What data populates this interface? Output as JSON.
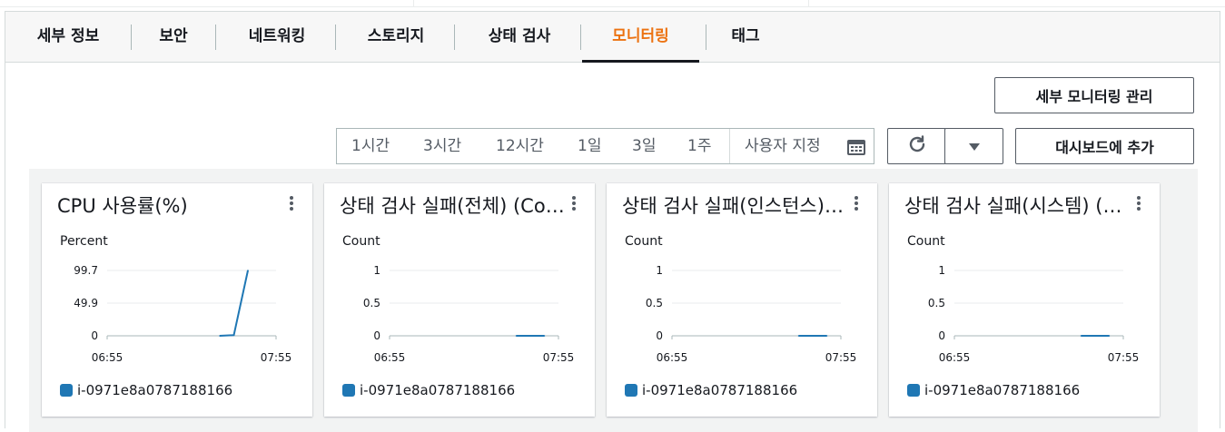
{
  "tabs": [
    {
      "label": "세부 정보",
      "active": false
    },
    {
      "label": "보안",
      "active": false
    },
    {
      "label": "네트워킹",
      "active": false
    },
    {
      "label": "스토리지",
      "active": false
    },
    {
      "label": "상태 검사",
      "active": false
    },
    {
      "label": "모니터링",
      "active": true
    },
    {
      "label": "태그",
      "active": false
    }
  ],
  "toolbar": {
    "manage_label": "세부 모니터링 관리",
    "ranges": [
      "1시간",
      "3시간",
      "12시간",
      "1일",
      "3일",
      "1주"
    ],
    "custom_label": "사용자 지정",
    "add_dashboard_label": "대시보드에 추가"
  },
  "colors": {
    "accent": "#ec7211",
    "series": "#1f77b4"
  },
  "charts": [
    {
      "title": "CPU 사용률(%)",
      "unit": "Percent",
      "legend": "i-0971e8a0787188166"
    },
    {
      "title": "상태 검사 실패(전체) (Count)",
      "unit": "Count",
      "legend": "i-0971e8a0787188166"
    },
    {
      "title": "상태 검사 실패(인스턴스) (Count)",
      "unit": "Count",
      "legend": "i-0971e8a0787188166"
    },
    {
      "title": "상태 검사 실패(시스템) (Count)",
      "unit": "Count",
      "legend": "i-0971e8a0787188166"
    }
  ],
  "chart_data": [
    {
      "type": "line",
      "title": "CPU 사용률(%)",
      "ylabel": "Percent",
      "ylim": [
        0,
        99.7
      ],
      "yticks": [
        "99.7",
        "49.9",
        "0"
      ],
      "xticks": [
        "06:55",
        "07:55"
      ],
      "x": [
        "07:35",
        "07:40",
        "07:45"
      ],
      "series": [
        {
          "name": "i-0971e8a0787188166",
          "values": [
            0,
            1,
            99.7
          ]
        }
      ]
    },
    {
      "type": "line",
      "title": "상태 검사 실패(전체)",
      "ylabel": "Count",
      "ylim": [
        0,
        1
      ],
      "yticks": [
        "1",
        "0.5",
        "0"
      ],
      "xticks": [
        "06:55",
        "07:55"
      ],
      "x": [
        "07:40",
        "07:50"
      ],
      "series": [
        {
          "name": "i-0971e8a0787188166",
          "values": [
            0,
            0
          ]
        }
      ]
    },
    {
      "type": "line",
      "title": "상태 검사 실패(인스턴스)",
      "ylabel": "Count",
      "ylim": [
        0,
        1
      ],
      "yticks": [
        "1",
        "0.5",
        "0"
      ],
      "xticks": [
        "06:55",
        "07:55"
      ],
      "x": [
        "07:40",
        "07:50"
      ],
      "series": [
        {
          "name": "i-0971e8a0787188166",
          "values": [
            0,
            0
          ]
        }
      ]
    },
    {
      "type": "line",
      "title": "상태 검사 실패(시스템)",
      "ylabel": "Count",
      "ylim": [
        0,
        1
      ],
      "yticks": [
        "1",
        "0.5",
        "0"
      ],
      "xticks": [
        "06:55",
        "07:55"
      ],
      "x": [
        "07:40",
        "07:50"
      ],
      "series": [
        {
          "name": "i-0971e8a0787188166",
          "values": [
            0,
            0
          ]
        }
      ]
    }
  ]
}
